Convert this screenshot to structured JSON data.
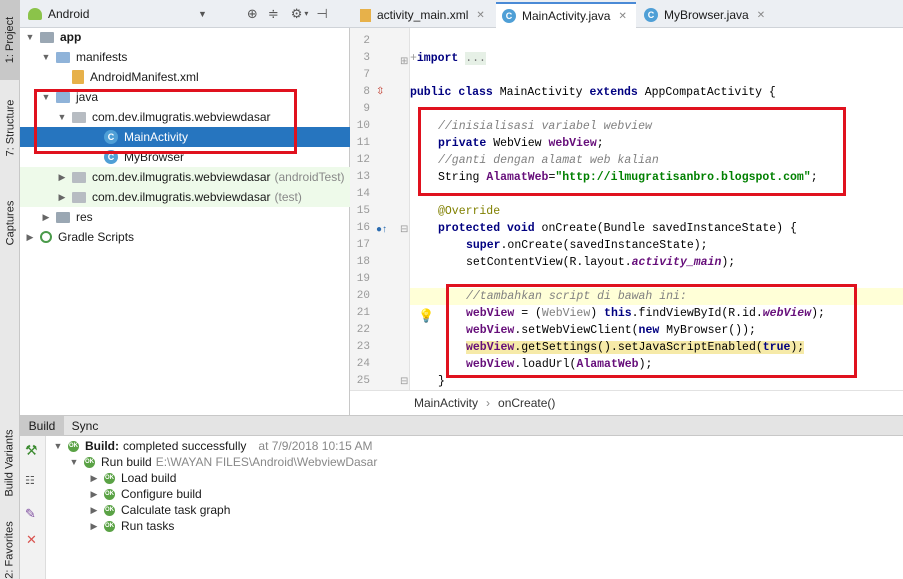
{
  "side_tabs": {
    "project": "1: Project",
    "structure": "7: Structure",
    "captures": "Captures",
    "build_variants": "Build Variants",
    "favorites": "2: Favorites"
  },
  "project_panel": {
    "view_selector": "Android",
    "toolbar_icons": [
      "android-icon",
      "dropdown-arrow-icon",
      "locate-icon",
      "collapse-icon",
      "settings-icon",
      "hide-icon"
    ],
    "tree": [
      {
        "label": "app",
        "bold": true
      },
      {
        "label": "manifests"
      },
      {
        "label": "AndroidManifest.xml"
      },
      {
        "label": "java"
      },
      {
        "label": "com.dev.ilmugratis.webviewdasar"
      },
      {
        "label": "MainActivity",
        "selected": true
      },
      {
        "label": "MyBrowser"
      },
      {
        "label": "com.dev.ilmugratis.webviewdasar",
        "suffix": "(androidTest)"
      },
      {
        "label": "com.dev.ilmugratis.webviewdasar",
        "suffix": "(test)"
      },
      {
        "label": "res"
      },
      {
        "label": "Gradle Scripts"
      }
    ]
  },
  "editor": {
    "tabs": [
      {
        "label": "activity_main.xml",
        "active": false
      },
      {
        "label": "MainActivity.java",
        "active": true
      },
      {
        "label": "MyBrowser.java",
        "active": false
      }
    ],
    "line_numbers": [
      "2",
      "3",
      "7",
      "8",
      "9",
      "10",
      "11",
      "12",
      "13",
      "14",
      "15",
      "16",
      "17",
      "18",
      "19",
      "20",
      "21",
      "22",
      "23",
      "24",
      "25"
    ],
    "code": {
      "l3_import": "import",
      "l3_fold": "...",
      "l8_public": "public",
      "l8_class": "class",
      "l8_name": "MainActivity",
      "l8_extends": "extends",
      "l8_super": "AppCompatActivity {",
      "l10": "//inisialisasi variabel webview",
      "l11_private": "private",
      "l11_type": "WebView",
      "l11_field": "webView",
      "l11_end": ";",
      "l12": "//ganti dengan alamat web kalian",
      "l13_type": "String",
      "l13_field": "AlamatWeb",
      "l13_eq": "=",
      "l13_str": "\"http://ilmugratisanbro.blogspot.com\"",
      "l13_end": ";",
      "l15": "@Override",
      "l16_protected": "protected",
      "l16_void": "void",
      "l16_rest": "onCreate(Bundle savedInstanceState) {",
      "l17_super": "super",
      "l17_rest": ".onCreate(savedInstanceState);",
      "l18_a": "setContentView(R.layout.",
      "l18_b": "activity_main",
      "l18_c": ");",
      "l20": "//tambahkan script di bawah ini:",
      "l21_a": "webView",
      "l21_b": " = (",
      "l21_c": "WebView",
      "l21_d": ") ",
      "l21_e": "this",
      "l21_f": ".findViewById(R.id.",
      "l21_g": "webView",
      "l21_h": ");",
      "l22_a": "webView",
      "l22_b": ".setWebViewClient(",
      "l22_c": "new",
      "l22_d": " MyBrowser());",
      "l23_a": "webView",
      "l23_b": ".getSettings().setJavaScriptEnabled(",
      "l23_c": "true",
      "l23_d": ");",
      "l24_a": "webView",
      "l24_b": ".loadUrl(",
      "l24_c": "AlamatWeb",
      "l24_d": ");",
      "l25": "}"
    },
    "breadcrumbs": [
      "MainActivity",
      "onCreate()"
    ],
    "breadcrumb_separator": "›"
  },
  "build": {
    "tabs": [
      {
        "label": "Build",
        "active": true
      },
      {
        "label": "Sync",
        "active": false
      }
    ],
    "status_label": "Build:",
    "status_text": "completed successfully",
    "timestamp": "at 7/9/2018 10:15 AM",
    "run_build_label": "Run build",
    "run_build_path": "E:\\WAYAN FILES\\Android\\WebviewDasar",
    "steps": [
      "Load build",
      "Configure build",
      "Calculate task graph",
      "Run tasks"
    ]
  },
  "colors": {
    "highlight_box": "#e0111e",
    "selection": "#2675bf",
    "success": "#5aa245",
    "keyword": "#000080",
    "string": "#008000",
    "field": "#660e7a",
    "comment": "#808080"
  }
}
